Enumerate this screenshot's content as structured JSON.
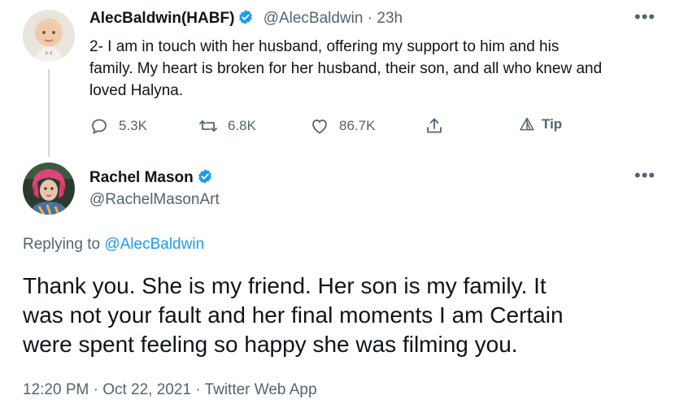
{
  "tweet1": {
    "author_name": "AlecBaldwin(HABF)",
    "handle": "@AlecBaldwin",
    "separator": "·",
    "time": "23h",
    "text_line1": "2- I am in touch with her husband, offering my support to him and his",
    "text_line2": "family. My heart is broken for her husband, their son, and all who knew and",
    "text_line3": "loved Halyna.",
    "replies": "5.3K",
    "retweets": "6.8K",
    "likes": "86.7K",
    "tip_label": "Tip"
  },
  "tweet2": {
    "author_name": "Rachel Mason",
    "handle": "@RachelMasonArt",
    "replying_prefix": "Replying to",
    "replying_handle": "@AlecBaldwin",
    "text_line1": "Thank you. She is my friend. Her son is my family. It",
    "text_line2": "was not your fault and her final moments I am Certain",
    "text_line3": "were spent feeling so happy she was filming you.",
    "timestamp": "12:20 PM · Oct 22, 2021 · Twitter Web App"
  },
  "more_label": "•••",
  "colors": {
    "accent": "#1d9bf0",
    "muted": "#536471",
    "line": "#cfd9de"
  }
}
